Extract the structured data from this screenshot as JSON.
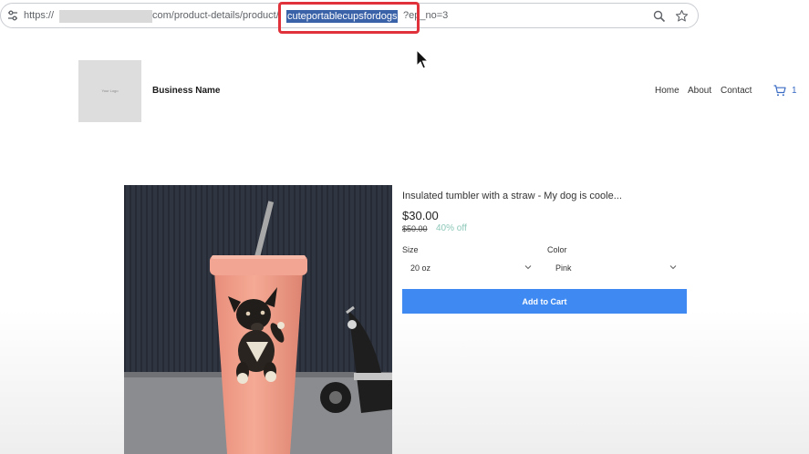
{
  "browser": {
    "url_prefix": "https://",
    "url_middle": "com/product-details/product/",
    "url_highlight": "cuteportablecupsfordogs",
    "url_suffix": "?ep_no=3"
  },
  "header": {
    "logo_text": "Your Logo",
    "business_name": "Business Name",
    "nav": [
      "Home",
      "About",
      "Contact"
    ],
    "cart_count": "1"
  },
  "product": {
    "title": "Insulated tumbler with a straw - My dog is coole...",
    "price": "$30.00",
    "original_price": "$50.00",
    "discount": "40% off",
    "size_label": "Size",
    "size_value": "20 oz",
    "color_label": "Color",
    "color_value": "Pink",
    "add_to_cart": "Add to Cart"
  },
  "colors": {
    "accent": "#3f89f2",
    "highlight": "#3a62a8",
    "annotation_red": "#e0323a",
    "discount_green": "#8cc7b8",
    "cup_pink": "#f0a28e"
  },
  "icons": [
    "tune-icon",
    "zoom-icon",
    "star-icon",
    "cursor-icon",
    "cart-icon",
    "chevron-down-icon"
  ]
}
